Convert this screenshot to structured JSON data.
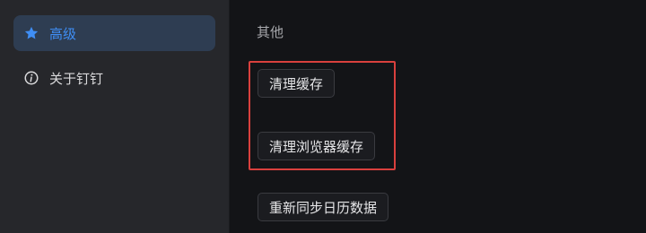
{
  "sidebar": {
    "items": [
      {
        "label": "高级",
        "icon": "star-icon",
        "active": true
      },
      {
        "label": "关于钉钉",
        "icon": "info-icon",
        "active": false
      }
    ]
  },
  "main": {
    "section_title": "其他",
    "buttons": [
      {
        "label": "清理缓存"
      },
      {
        "label": "清理浏览器缓存"
      },
      {
        "label": "重新同步日历数据"
      }
    ]
  },
  "colors": {
    "accent": "#3f8ef5",
    "active_bg": "#2e3d52",
    "sidebar_bg": "#26272b",
    "main_bg": "#131417",
    "highlight": "#d9403d"
  }
}
